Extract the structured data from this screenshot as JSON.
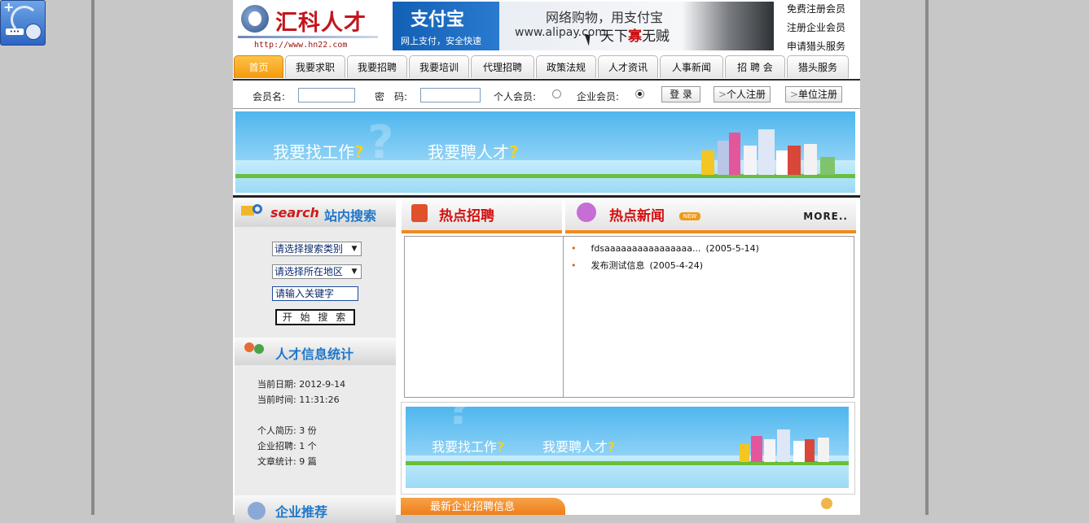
{
  "site": {
    "logo_text": "汇科人才",
    "url_text": "http://www.hn22.com"
  },
  "ad": {
    "brand": "支付宝",
    "tagline": "网上支付，安全快速",
    "headline": "网络购物，用支付宝",
    "domain": "www.alipay.com",
    "slogan_a": "天下",
    "slogan_b": "寡",
    "slogan_c": "无贼"
  },
  "top_links": [
    "免费注册会员",
    "注册企业会员",
    "申请猎头服务"
  ],
  "nav": [
    {
      "label": "首页",
      "active": true
    },
    {
      "label": "我要求职",
      "active": false
    },
    {
      "label": "我要招聘",
      "active": false
    },
    {
      "label": "我要培训",
      "active": false
    },
    {
      "label": "代理招聘",
      "active": false
    },
    {
      "label": "政策法规",
      "active": false
    },
    {
      "label": "人才资讯",
      "active": false
    },
    {
      "label": "人事新闻",
      "active": false
    },
    {
      "label": "招 聘 会",
      "active": false
    },
    {
      "label": "猎头服务",
      "active": false
    }
  ],
  "login": {
    "username_label": "会员名:",
    "password_label": "密　码:",
    "personal_label": "个人会员:",
    "company_label": "企业会员:",
    "login_button": "登 录",
    "personal_register": "个人注册",
    "company_register": "单位注册",
    "selected_type": "company"
  },
  "banner": {
    "left_text": "我要找工作",
    "right_text": "我要聘人才",
    "q": "?"
  },
  "search": {
    "title_en": "search",
    "title_cn": "站内搜索",
    "category_select": "请选择搜索类别",
    "region_select": "请选择所在地区",
    "keyword_value": "请输入关键字",
    "submit": "开 始 搜 索"
  },
  "stats": {
    "title": "人才信息统计",
    "date_label": "当前日期:",
    "date_value": "2012-9-14",
    "time_label": "当前时间:",
    "time_value": "11:31:26",
    "resumes": "个人简历: 3 份",
    "jobs": "企业招聘: 1 个",
    "articles": "文章统计: 9 篇"
  },
  "hot_jobs": {
    "title": "热点招聘"
  },
  "hot_news": {
    "title": "热点新闻",
    "badge": "NEW",
    "more": "MORE..",
    "items": [
      {
        "title": "fdsaaaaaaaaaaaaaaaa...",
        "date": "(2005-5-14)"
      },
      {
        "title": "发布测试信息",
        "date": "(2005-4-24)"
      }
    ]
  },
  "company": {
    "title": "企业推荐"
  },
  "latest": {
    "title": "最新企业招聘信息"
  },
  "colors": {
    "nav_active": "#f39a0b",
    "hot_title": "#d40f0f",
    "accent_orange": "#f08a1c",
    "banner_sky": "#4fb6ee"
  }
}
